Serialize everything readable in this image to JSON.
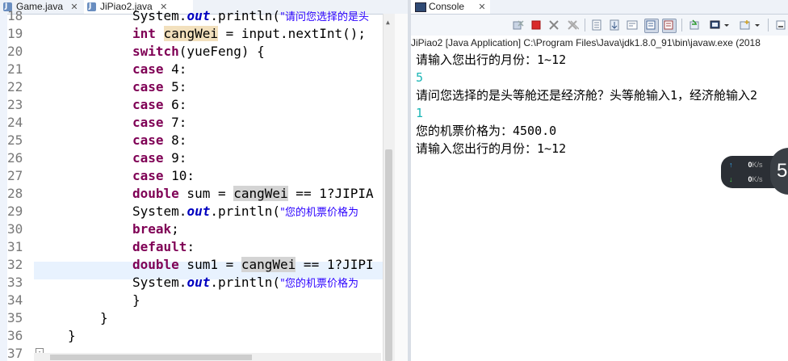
{
  "editor": {
    "tabs": [
      {
        "label": "Game.java"
      },
      {
        "label": "JiPiao2.java"
      }
    ],
    "close_glyph": "✕",
    "icon": "java-file-icon",
    "lines": [
      {
        "no": "18"
      },
      {
        "no": "19"
      },
      {
        "no": "20"
      },
      {
        "no": "21"
      },
      {
        "no": "22"
      },
      {
        "no": "23"
      },
      {
        "no": "24"
      },
      {
        "no": "25"
      },
      {
        "no": "26"
      },
      {
        "no": "27"
      },
      {
        "no": "28"
      },
      {
        "no": "29"
      },
      {
        "no": "30"
      },
      {
        "no": "31"
      },
      {
        "no": "32"
      },
      {
        "no": "33"
      },
      {
        "no": "34"
      },
      {
        "no": "35"
      },
      {
        "no": "36"
      },
      {
        "no": "37"
      }
    ],
    "code": {
      "l18": {
        "a": "System.",
        "b": "out",
        "c": ".println(",
        "d": "\"请问您选择的是头"
      },
      "l19": {
        "kw": "int",
        "sp": " ",
        "var": "cangWei",
        "rest": " = input.nextInt();"
      },
      "l20": {
        "kw": "switch",
        "rest": "(yueFeng) {"
      },
      "l21": {
        "kw": "case",
        "rest": " 4:"
      },
      "l22": {
        "kw": "case",
        "rest": " 5:"
      },
      "l23": {
        "kw": "case",
        "rest": " 6:"
      },
      "l24": {
        "kw": "case",
        "rest": " 7:"
      },
      "l25": {
        "kw": "case",
        "rest": " 8:"
      },
      "l26": {
        "kw": "case",
        "rest": " 9:"
      },
      "l27": {
        "kw": "case",
        "rest": " 10:"
      },
      "l28": {
        "kw": "double",
        "a": " sum = ",
        "var": "cangWei",
        "rest": " == 1?JIPIA"
      },
      "l29": {
        "a": "System.",
        "b": "out",
        "c": ".println(",
        "d": "\"您的机票价格为"
      },
      "l30": {
        "kw": "break",
        "rest": ";"
      },
      "l31": {
        "kw": "default",
        "rest": ":"
      },
      "l32": {
        "kw": "double",
        "a": " sum1 = ",
        "var": "cangWei",
        "rest": " == 1?JIPI"
      },
      "l33": {
        "a": "System.",
        "b": "out",
        "c": ".println(",
        "d": "\"您的机票价格为"
      },
      "l34": {
        "text": "}"
      },
      "l35": {
        "text": "}"
      },
      "l36": {
        "text": "}"
      }
    },
    "collapse_glyph": "-"
  },
  "console": {
    "tab_label": "Console",
    "close_glyph": "✕",
    "launch_info": "JiPiao2 [Java Application] C:\\Program Files\\Java\\jdk1.8.0_91\\bin\\javaw.exe (2018",
    "output": [
      {
        "kind": "sys",
        "text": "请输入您出行的月份：1~12"
      },
      {
        "kind": "in",
        "text": "5"
      },
      {
        "kind": "sys",
        "text": "请问您选择的是头等舱还是经济舱？头等舱输入1，经济舱输入2"
      },
      {
        "kind": "in",
        "text": "1"
      },
      {
        "kind": "sys",
        "text": "您的机票价格为：4500.0"
      },
      {
        "kind": "sys",
        "text": "请输入您出行的月份：1~12"
      }
    ],
    "toolbar_icons": [
      "remove-launch-icon",
      "terminate-icon",
      "remove-all-icon",
      "clear-console-icon",
      "scroll-lock-icon",
      "show-on-output-icon",
      "show-on-error-icon",
      "pin-console-icon",
      "display-console-icon",
      "open-console-icon",
      "minimize-icon"
    ]
  },
  "network_widget": {
    "up_arrow": "↑",
    "down_arrow": "↓",
    "up_value": "0",
    "up_unit": "K/s",
    "down_value": "0",
    "down_unit": "K/s",
    "badge": "5"
  },
  "colors": {
    "keyword": "#7f0055",
    "field": "#0000c0",
    "string": "#2a00ff",
    "console_input": "#1ab5b5",
    "current_line": "#e8f2fe"
  }
}
